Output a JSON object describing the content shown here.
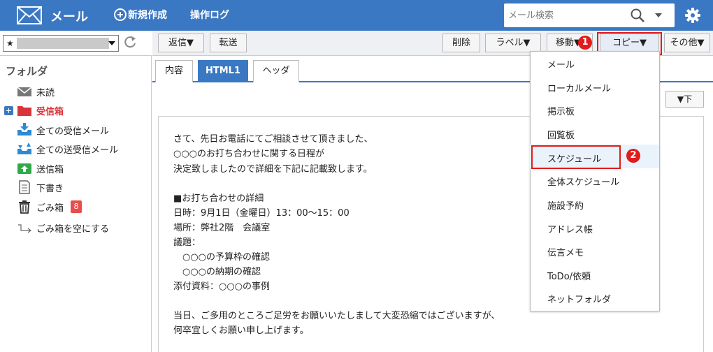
{
  "header": {
    "app_title": "メール",
    "new_label": "新規作成",
    "log_label": "操作ログ",
    "search_placeholder": "メール検索"
  },
  "account": {
    "prefix": "★"
  },
  "sidebar": {
    "heading": "フォルダ",
    "items": [
      {
        "label": "未読"
      },
      {
        "label": "受信箱"
      },
      {
        "label": "全ての受信メール"
      },
      {
        "label": "全ての送受信メール"
      },
      {
        "label": "送信箱"
      },
      {
        "label": "下書き"
      },
      {
        "label": "ごみ箱",
        "badge": "8"
      },
      {
        "label": "ごみ箱を空にする"
      }
    ]
  },
  "toolbar": {
    "reply": "返信▼",
    "forward": "転送",
    "delete": "削除",
    "label": "ラベル▼",
    "move": "移動▼",
    "copy": "コピー▼",
    "other": "その他▼"
  },
  "tabs": [
    "内容",
    "HTML1",
    "ヘッダ"
  ],
  "down_button": "▼下",
  "message": {
    "lines": [
      "さて、先日お電話にてご相談させて頂きました、",
      "○○○のお打ち合わせに関する日程が",
      "決定致しましたので詳細を下記に記載致します。",
      "",
      "■お打ち合わせの詳細",
      "日時：9月1日（金曜日）13：00～15：00",
      "場所：弊社2階　会議室",
      "議題：",
      "　○○○の予算枠の確認",
      "　○○○の納期の確認",
      "添付資料：○○○の事例",
      "",
      "当日、ご多用のところご足労をお願いいたしまして大変恐縮ではございますが、",
      "何卒宜しくお願い申し上げます。"
    ]
  },
  "copy_menu": {
    "items": [
      "メール",
      "ローカルメール",
      "掲示板",
      "回覧板",
      "スケジュール",
      "全体スケジュール",
      "施設予約",
      "アドレス帳",
      "伝言メモ",
      "ToDo/依頼",
      "ネットフォルダ"
    ]
  },
  "callouts": [
    "1",
    "2"
  ],
  "colors": {
    "header": "#3b78c3",
    "accent": "#d9343a",
    "highlight": "#e21b1b"
  }
}
